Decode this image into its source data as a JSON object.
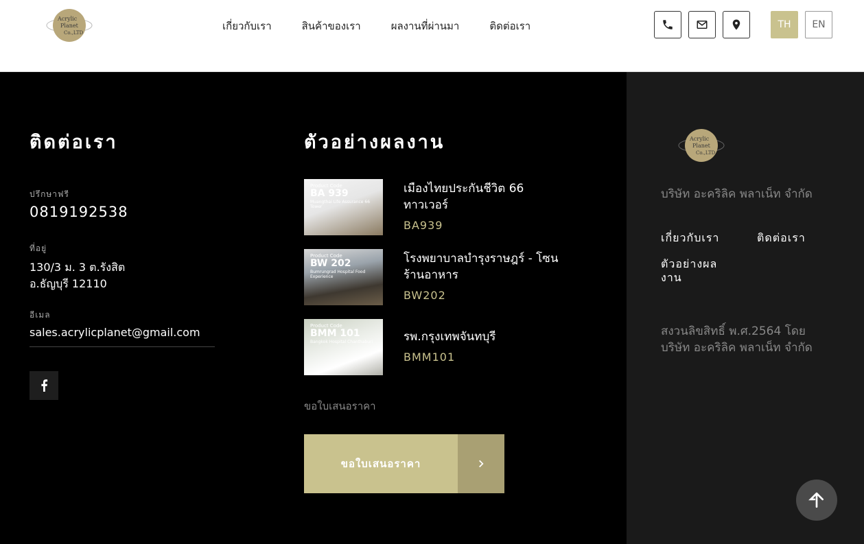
{
  "header": {
    "logo_text": [
      "Acrylic",
      "Planet",
      "Co.,LTD"
    ],
    "nav": [
      "เกี่ยวกับเรา",
      "สินค้าของเรา",
      "ผลงานที่ผ่านมา",
      "ติดต่อเรา"
    ],
    "icons": [
      "phone-icon",
      "mail-icon",
      "location-icon"
    ],
    "lang_active": "TH",
    "lang_inactive": "EN"
  },
  "contact": {
    "title": "ติดต่อเรา",
    "free_consult_label": "ปรึกษาฟรี",
    "phone": "0819192538",
    "address_label": "ที่อยู่",
    "address_line1": "130/3 ม. 3 ต.รังสิต",
    "address_line2": "อ.ธัญบุรี 12110",
    "email_label": "อีเมล",
    "email": "sales.acrylicplanet@gmail.com"
  },
  "works": {
    "title": "ตัวอย่างผลงาน",
    "items": [
      {
        "name_line1": "เมืองไทยประกันชีวิต 66",
        "name_line2": "ทาวเวอร์",
        "code": "BA939",
        "thumb_code": "BA 939",
        "thumb_sub": "Muangthai Life Assurance 66 Tower"
      },
      {
        "name_line1": "โรงพยาบาลบำรุงราษฎร์ - โซน",
        "name_line2": "ร้านอาหาร",
        "code": "BW202",
        "thumb_code": "BW 202",
        "thumb_sub": "Bumrungrad Hospital Food Experience"
      },
      {
        "name_line1": "รพ.กรุงเทพจันทบุรี",
        "name_line2": "",
        "code": "BMM101",
        "thumb_code": "BMM 101",
        "thumb_sub": "Bangkok Hospital Chanthaburi"
      }
    ],
    "thumb_label": "Product Code",
    "quote_small": "ขอใบเสนอราคา",
    "quote_button": "ขอใบเสนอราคา"
  },
  "right_panel": {
    "company": "บริษัท อะคริลิค พลาเน็ท จำกัด",
    "link_about": "เกี่ยวกับเรา",
    "link_contact": "ติดต่อเรา",
    "link_works_1": "ตัวอย่างผล",
    "link_works_2": "งาน",
    "copyright_1": "สงวนลิขสิทธิ์ พ.ศ.2564 โดย",
    "copyright_2": "บริษัท อะคริลิค พลาเน็ท จำกัด"
  },
  "colors": {
    "accent": "#c9c28e",
    "accent_dark": "#a9a073",
    "panel": "#1a1a1a"
  }
}
